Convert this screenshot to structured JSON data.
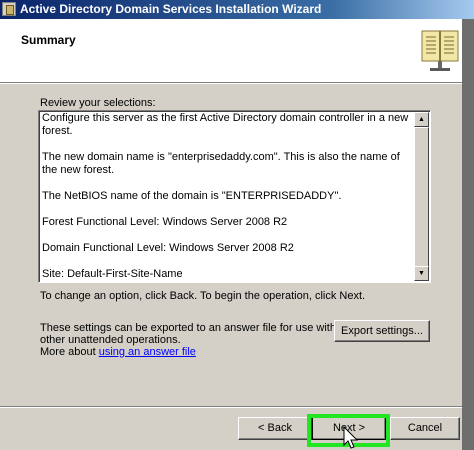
{
  "window": {
    "title": "Active Directory Domain Services Installation Wizard"
  },
  "header": {
    "heading": "Summary",
    "icon": "book-icon"
  },
  "review": {
    "label": "Review your selections:",
    "lines": [
      "Configure this server as the first Active Directory domain controller in a new forest.",
      "The new domain name is \"enterprisedaddy.com\". This is also the name of the new forest.",
      "The NetBIOS name of the domain is \"ENTERPRISEDADDY\".",
      "Forest Functional Level: Windows Server 2008 R2",
      "Domain Functional Level: Windows Server 2008 R2",
      "Site: Default-First-Site-Name"
    ]
  },
  "instructions": {
    "change_text": "To change an option, click Back. To begin the operation, click Next.",
    "export_text": "These settings can be exported to an answer file for use with other unattended operations.",
    "more_about_prefix": "More about ",
    "more_about_link": "using an answer file"
  },
  "buttons": {
    "export": "Export settings...",
    "back": "< Back",
    "next": "Next >",
    "cancel": "Cancel"
  },
  "colors": {
    "title_start": "#0a246a",
    "title_end": "#a6caf0",
    "dialog_face": "#d4d0c8",
    "highlight": "#22e622",
    "link": "#0000ff"
  }
}
